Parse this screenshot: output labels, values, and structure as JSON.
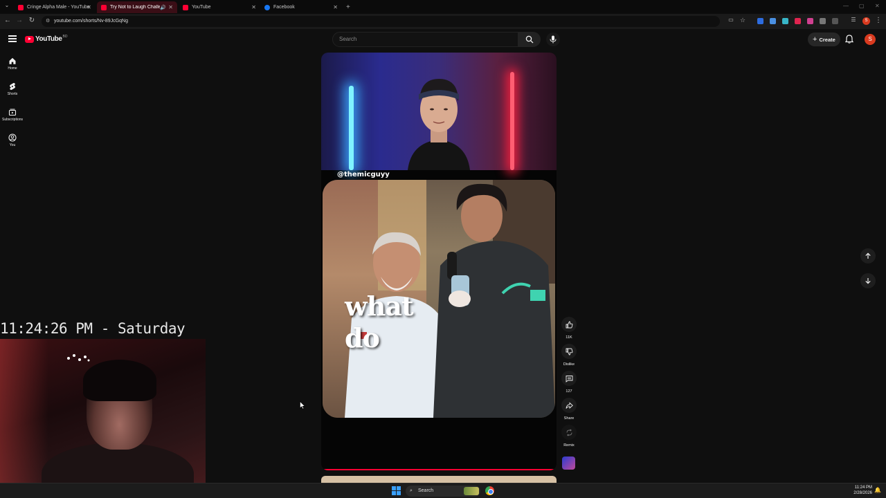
{
  "browser": {
    "tabs": [
      {
        "title": "Cringe Alpha Male - YouTube",
        "icon": "youtube-icon",
        "active": false
      },
      {
        "title": "Try Not to Laugh Challenge",
        "icon": "youtube-icon",
        "active": true,
        "audio": true
      },
      {
        "title": "YouTube",
        "icon": "youtube-icon",
        "active": false
      },
      {
        "title": "Facebook",
        "icon": "facebook-icon",
        "active": false
      }
    ],
    "new_tab": "+",
    "url": "youtube.com/shorts/Nv-89JcGqNg",
    "profile_letter": "S"
  },
  "youtube": {
    "logo_text": "YouTube",
    "country_code": "BD",
    "search_placeholder": "Search",
    "create_label": "Create",
    "avatar_letter": "S",
    "guide": [
      {
        "label": "Home",
        "icon": "home-icon"
      },
      {
        "label": "Shorts",
        "icon": "shorts-icon"
      },
      {
        "label": "Subscriptions",
        "icon": "subscriptions-icon"
      },
      {
        "label": "You",
        "icon": "you-icon"
      }
    ]
  },
  "short": {
    "handle": "@themicguyy",
    "caption_line1": "what",
    "caption_line2": "do",
    "progress": 1.0,
    "actions": {
      "like_count": "11K",
      "dislike_label": "Dislike",
      "comment_count": "127",
      "share_label": "Share",
      "remix_label": "Remix"
    }
  },
  "overlay": {
    "clock_text": "11:24:26 PM - Saturday"
  },
  "taskbar": {
    "search_label": "Search",
    "time": "11:24 PM",
    "date": "2/28/2026"
  },
  "colors": {
    "youtube_red": "#ff0033",
    "background": "#0f0f0f",
    "avatar": "#d93a1f",
    "windows_blue": "#3aa0ff"
  }
}
